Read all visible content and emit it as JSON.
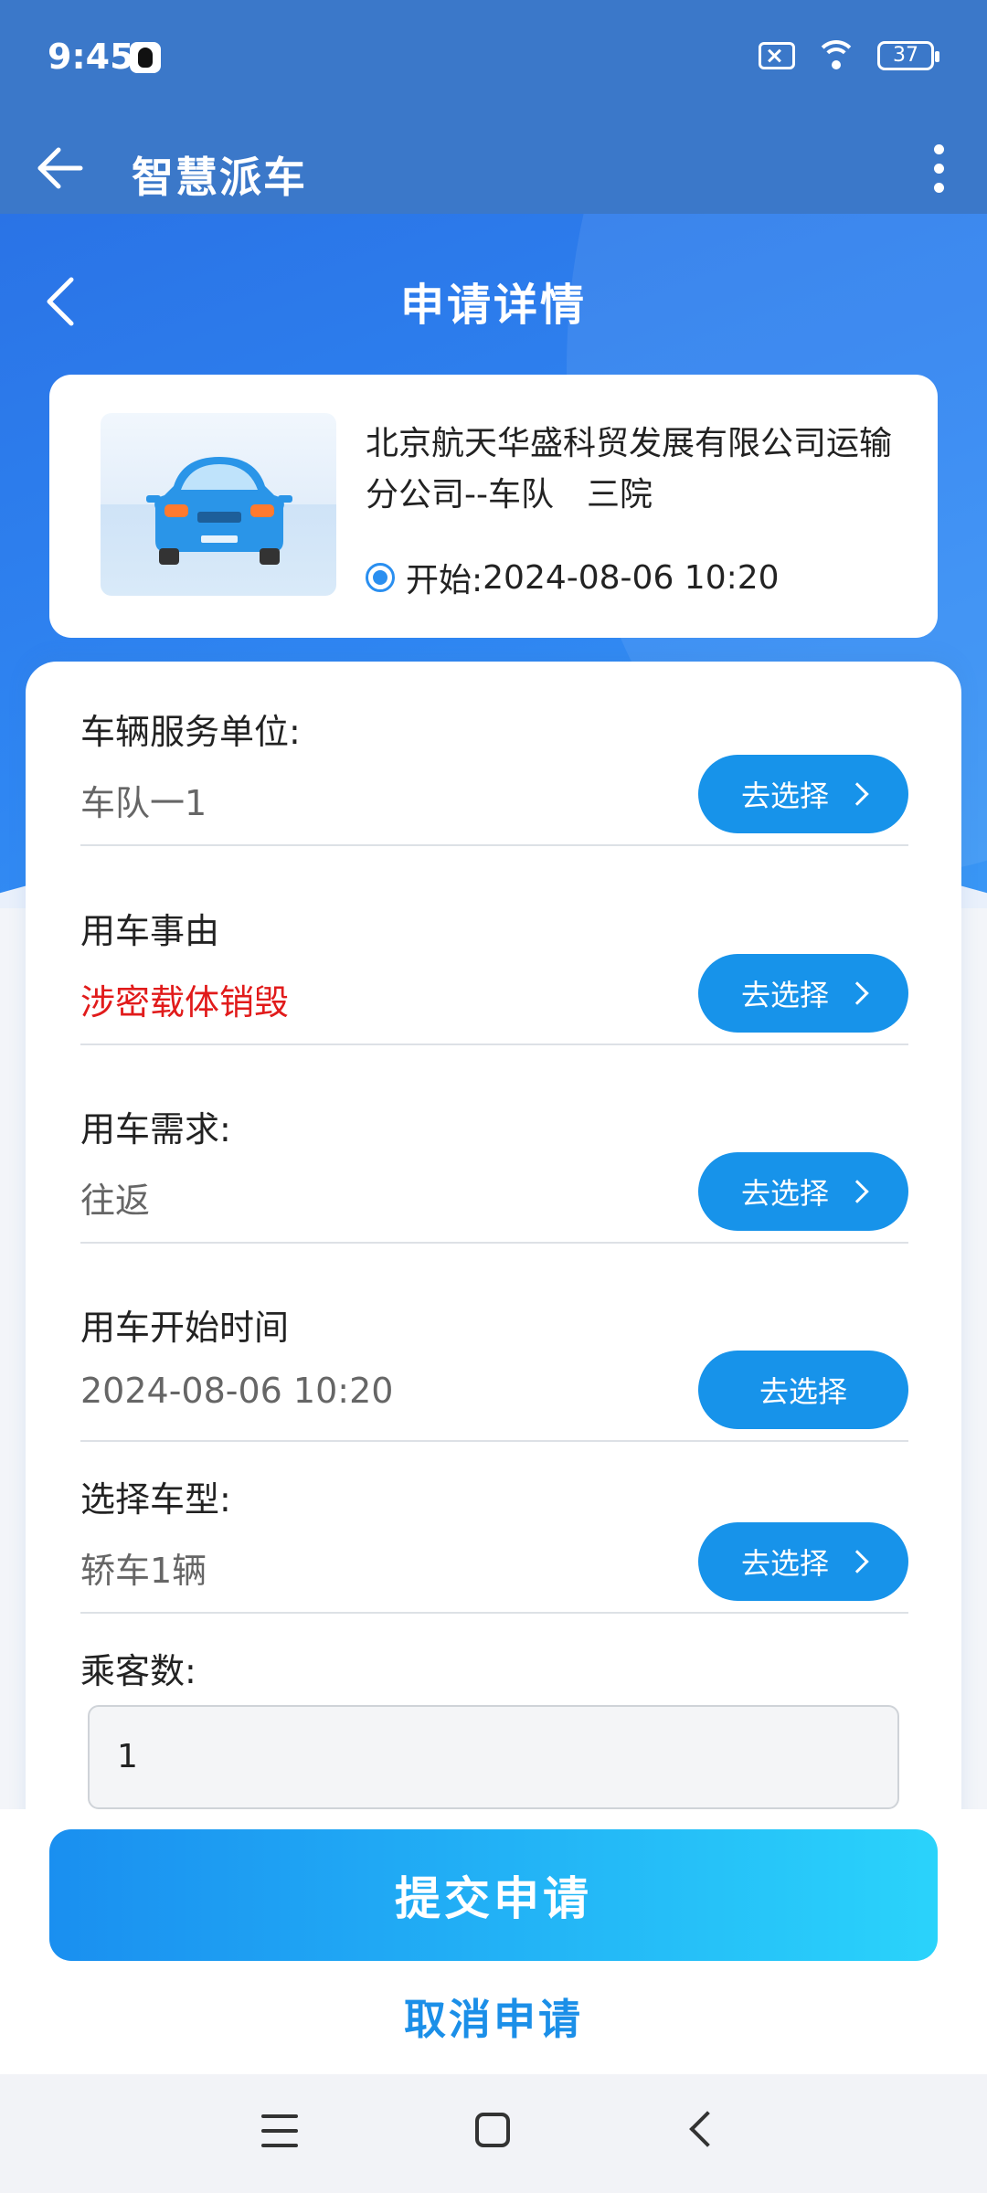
{
  "status_bar": {
    "time": "9:45",
    "battery": "37"
  },
  "app_bar": {
    "title": "智慧派车"
  },
  "page": {
    "title": "申请详情"
  },
  "info_card": {
    "org_name": "北京航天华盛科贸发展有限公司运输分公司--车队　三院",
    "start_label": "开始:",
    "start_time": "2024-08-06 10:20"
  },
  "form": {
    "fields": [
      {
        "label": "车辆服务单位:",
        "value": "车队一1",
        "button": "去选择"
      },
      {
        "label": "用车事由",
        "value": "涉密载体销毁",
        "button": "去选择",
        "value_color": "#e11b1b"
      },
      {
        "label": "用车需求:",
        "value": "往返",
        "button": "去选择"
      },
      {
        "label": "用车开始时间",
        "value": "2024-08-06 10:20",
        "button": "去选择"
      },
      {
        "label": "选择车型:",
        "value": "轿车1辆",
        "button": "去选择"
      }
    ],
    "passengers": {
      "label": "乘客数:",
      "value": "1"
    }
  },
  "actions": {
    "submit": "提交申请",
    "cancel": "取消申请"
  },
  "colors": {
    "primary": "#1793ea",
    "app_bar": "#3b78c9",
    "alert_text": "#e11b1b"
  }
}
